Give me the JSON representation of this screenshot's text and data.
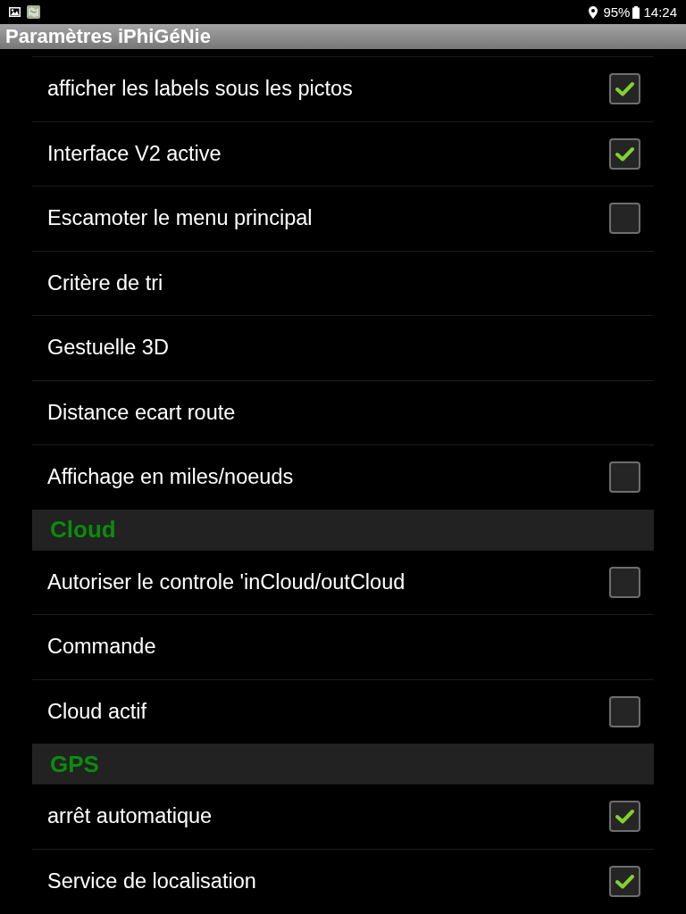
{
  "status_bar": {
    "battery": "95%",
    "time": "14:24"
  },
  "title": "Paramètres iPhiGéNie",
  "settings": [
    {
      "kind": "checkbox",
      "label": "afficher les labels sous les pictos",
      "checked": true
    },
    {
      "kind": "checkbox",
      "label": "Interface V2 active",
      "checked": true
    },
    {
      "kind": "checkbox",
      "label": "Escamoter le menu principal",
      "checked": false
    },
    {
      "kind": "item",
      "label": "Critère de tri"
    },
    {
      "kind": "item",
      "label": "Gestuelle 3D"
    },
    {
      "kind": "item",
      "label": "Distance ecart route"
    },
    {
      "kind": "checkbox",
      "label": "Affichage en miles/noeuds",
      "checked": false
    },
    {
      "kind": "section",
      "label": "Cloud"
    },
    {
      "kind": "checkbox",
      "label": "Autoriser le controle 'inCloud/outCloud",
      "checked": false
    },
    {
      "kind": "item",
      "label": "Commande"
    },
    {
      "kind": "checkbox",
      "label": "Cloud actif",
      "checked": false
    },
    {
      "kind": "section",
      "label": "GPS"
    },
    {
      "kind": "checkbox",
      "label": "arrêt automatique",
      "checked": true
    },
    {
      "kind": "checkbox",
      "label": "Service de localisation",
      "checked": true
    }
  ]
}
